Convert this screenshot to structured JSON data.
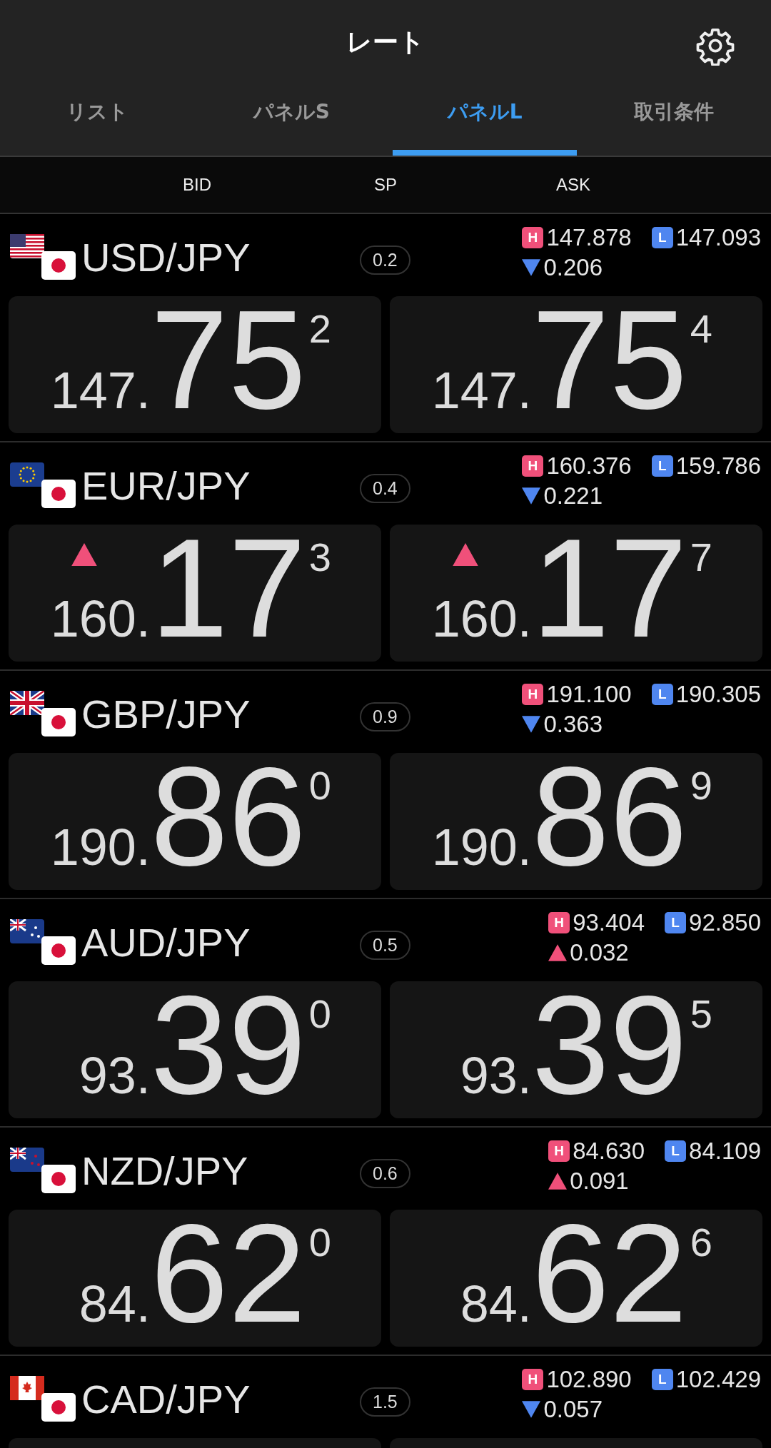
{
  "header": {
    "title": "レート"
  },
  "tabs": [
    {
      "label": "リスト",
      "selected": false
    },
    {
      "label": "パネルS",
      "selected": false
    },
    {
      "label": "パネルL",
      "selected": true
    },
    {
      "label": "取引条件",
      "selected": false
    }
  ],
  "columns": [
    "BID",
    "SP",
    "ASK"
  ],
  "pairs": [
    {
      "kind": "us",
      "name": "USD/JPY",
      "spread": "0.2",
      "high_badge": "H",
      "high": "147.878",
      "low_badge": "L",
      "low": "147.093",
      "change_up": false,
      "change": "0.206",
      "bid": {
        "prefix": "147.",
        "big": "75",
        "pip": "2"
      },
      "ask": {
        "prefix": "147.",
        "big": "75",
        "pip": "4"
      }
    },
    {
      "kind": "eu",
      "name": "EUR/JPY",
      "spread": "0.4",
      "high_badge": "H",
      "high": "160.376",
      "low_badge": "L",
      "low": "159.786",
      "change_up": false,
      "change": "0.221",
      "bid": {
        "prefix": "160.",
        "big": "17",
        "pip": "3",
        "uptick": true
      },
      "ask": {
        "prefix": "160.",
        "big": "17",
        "pip": "7",
        "uptick": true
      }
    },
    {
      "kind": "gb",
      "name": "GBP/JPY",
      "spread": "0.9",
      "high_badge": "H",
      "high": "191.100",
      "low_badge": "L",
      "low": "190.305",
      "change_up": false,
      "change": "0.363",
      "bid": {
        "prefix": "190.",
        "big": "86",
        "pip": "0"
      },
      "ask": {
        "prefix": "190.",
        "big": "86",
        "pip": "9"
      }
    },
    {
      "kind": "au",
      "name": "AUD/JPY",
      "spread": "0.5",
      "high_badge": "H",
      "high": "93.404",
      "low_badge": "L",
      "low": "92.850",
      "change_up": true,
      "change": "0.032",
      "bid": {
        "prefix": "93.",
        "big": "39",
        "pip": "0"
      },
      "ask": {
        "prefix": "93.",
        "big": "39",
        "pip": "5"
      }
    },
    {
      "kind": "nz",
      "name": "NZD/JPY",
      "spread": "0.6",
      "high_badge": "H",
      "high": "84.630",
      "low_badge": "L",
      "low": "84.109",
      "change_up": true,
      "change": "0.091",
      "bid": {
        "prefix": "84.",
        "big": "62",
        "pip": "0"
      },
      "ask": {
        "prefix": "84.",
        "big": "62",
        "pip": "6"
      }
    },
    {
      "kind": "ca",
      "name": "CAD/JPY",
      "spread": "1.5",
      "high_badge": "H",
      "high": "102.890",
      "low_badge": "L",
      "low": "102.429",
      "change_up": false,
      "change": "0.057"
    }
  ]
}
